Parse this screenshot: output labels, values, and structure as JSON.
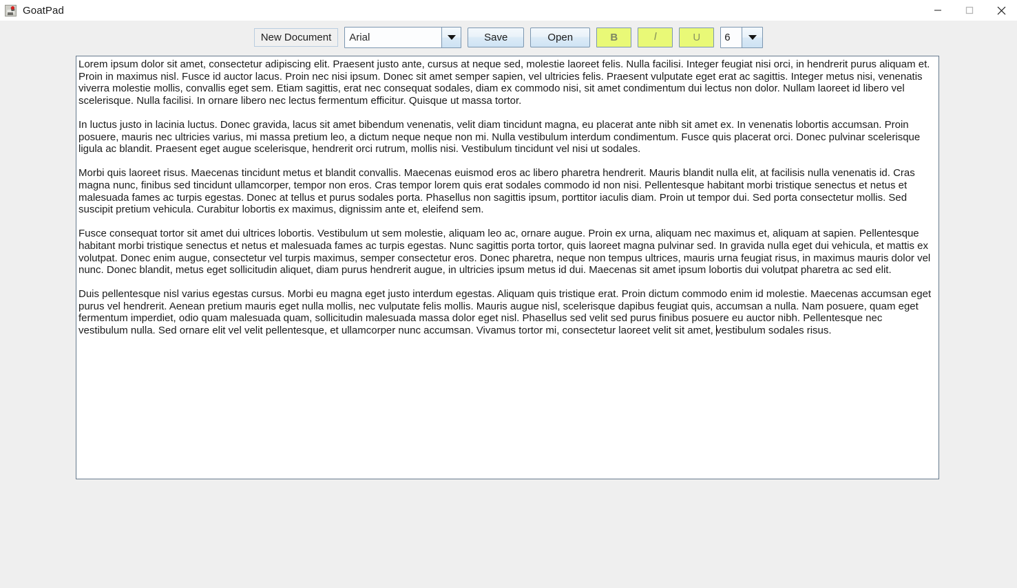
{
  "window": {
    "title": "GoatPad",
    "icon": "goat-app-icon",
    "controls": {
      "minimize": "minimize-icon",
      "maximize": "maximize-icon",
      "close": "close-icon"
    }
  },
  "toolbar": {
    "new_document_label": "New Document",
    "font_family": {
      "value": "Arial",
      "arrow_icon": "chevron-down-icon"
    },
    "save_label": "Save",
    "open_label": "Open",
    "bold_label": "B",
    "italic_label": "I",
    "underline_label": "U",
    "font_size": {
      "value": "6",
      "arrow_icon": "chevron-down-icon"
    },
    "active_format_color": "#e9f977",
    "button_border_color": "#7b96b0"
  },
  "editor": {
    "font_name": "Arial",
    "paragraphs": [
      "Lorem ipsum dolor sit amet, consectetur adipiscing elit. Praesent justo ante, cursus at neque sed, molestie laoreet felis. Nulla facilisi. Integer feugiat nisi orci, in hendrerit purus aliquam et. Proin in maximus nisl. Fusce id auctor lacus. Proin nec nisi ipsum. Donec sit amet semper sapien, vel ultricies felis. Praesent vulputate eget erat ac sagittis. Integer metus nisi, venenatis viverra molestie mollis, convallis eget sem. Etiam sagittis, erat nec consequat sodales, diam ex commodo nisi, sit amet condimentum dui lectus non dolor. Nullam laoreet id libero vel scelerisque. Nulla facilisi. In ornare libero nec lectus fermentum efficitur. Quisque ut massa tortor.",
      "In luctus justo in lacinia luctus. Donec gravida, lacus sit amet bibendum venenatis, velit diam tincidunt magna, eu placerat ante nibh sit amet ex. In venenatis lobortis accumsan. Proin posuere, mauris nec ultricies varius, mi massa pretium leo, a dictum neque neque non mi. Nulla vestibulum interdum condimentum. Fusce quis placerat orci. Donec pulvinar scelerisque ligula ac blandit. Praesent eget augue scelerisque, hendrerit orci rutrum, mollis nisi. Vestibulum tincidunt vel nisi ut sodales.",
      "Morbi quis laoreet risus. Maecenas tincidunt metus et blandit convallis. Maecenas euismod eros ac libero pharetra hendrerit. Mauris blandit nulla elit, at facilisis nulla venenatis id. Cras magna nunc, finibus sed tincidunt ullamcorper, tempor non eros. Cras tempor lorem quis erat sodales commodo id non nisi. Pellentesque habitant morbi tristique senectus et netus et malesuada fames ac turpis egestas. Donec at tellus et purus sodales porta. Phasellus non sagittis ipsum, porttitor iaculis diam. Proin ut tempor dui. Sed porta consectetur mollis. Sed suscipit pretium vehicula. Curabitur lobortis ex maximus, dignissim ante et, eleifend sem.",
      "Fusce consequat tortor sit amet dui ultrices lobortis. Vestibulum ut sem molestie, aliquam leo ac, ornare augue. Proin ex urna, aliquam nec maximus et, aliquam at sapien. Pellentesque habitant morbi tristique senectus et netus et malesuada fames ac turpis egestas. Nunc sagittis porta tortor, quis laoreet magna pulvinar sed. In gravida nulla eget dui vehicula, et mattis ex volutpat. Donec enim augue, consectetur vel turpis maximus, semper consectetur eros. Donec pharetra, neque non tempus ultrices, mauris urna feugiat risus, in maximus mauris dolor vel nunc. Donec blandit, metus eget sollicitudin aliquet, diam purus hendrerit augue, in ultricies ipsum metus id dui. Maecenas sit amet ipsum lobortis dui volutpat pharetra ac sed elit.",
      "Duis pellentesque nisl varius egestas cursus. Morbi eu magna eget justo interdum egestas. Aliquam quis tristique erat. Proin dictum commodo enim id molestie. Maecenas accumsan eget purus vel hendrerit. Aenean pretium mauris eget nulla mollis, nec vulputate felis mollis. Mauris augue nisl, scelerisque dapibus feugiat quis, accumsan a nulla. Nam posuere, quam eget fermentum imperdiet, odio quam malesuada quam, sollicitudin malesuada massa dolor eget nisl. Phasellus sed velit sed purus finibus posuere eu auctor nibh. Pellentesque nec vestibulum nulla. Sed ornare elit vel velit pellentesque, et ullamcorper nunc accumsan. Vivamus tortor mi, consectetur laoreet velit sit amet, vestibulum sodales risus."
    ]
  },
  "colors": {
    "window_background": "#efefef",
    "titlebar_background": "#ffffff",
    "editor_background": "#ffffff",
    "editor_border": "#65798c",
    "highlight": "#e9f977"
  }
}
